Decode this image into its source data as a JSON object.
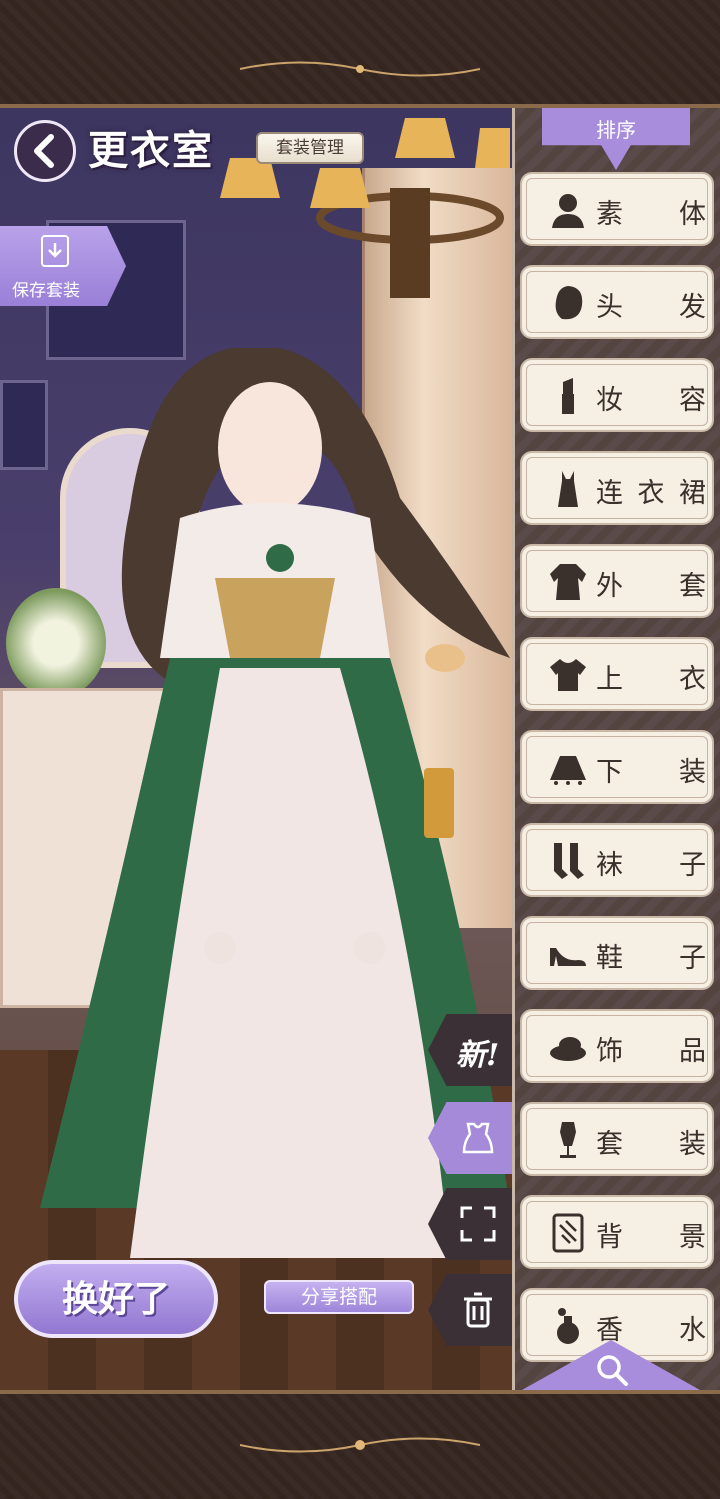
{
  "header": {
    "title": "更衣室",
    "outfit_management": "套装管理",
    "save_outfit": "保存套装"
  },
  "sidebar": {
    "sort_label": "排序",
    "categories": [
      {
        "label": "素 体",
        "icon": "body-icon"
      },
      {
        "label": "头 发",
        "icon": "hair-icon"
      },
      {
        "label": "妆 容",
        "icon": "lipstick-icon"
      },
      {
        "label": "连衣裙",
        "icon": "dress-icon"
      },
      {
        "label": "外 套",
        "icon": "coat-icon"
      },
      {
        "label": "上 衣",
        "icon": "top-icon"
      },
      {
        "label": "下 装",
        "icon": "skirt-icon"
      },
      {
        "label": "袜 子",
        "icon": "socks-icon"
      },
      {
        "label": "鞋 子",
        "icon": "shoe-icon"
      },
      {
        "label": "饰 品",
        "icon": "hat-icon"
      },
      {
        "label": "套 装",
        "icon": "mannequin-icon"
      },
      {
        "label": "背 景",
        "icon": "background-icon"
      },
      {
        "label": "香 水",
        "icon": "perfume-icon"
      }
    ],
    "search_icon": "search-icon"
  },
  "side_controls": {
    "new_label": "新!",
    "outfit_icon": "outfit-icon",
    "expand_icon": "expand-icon",
    "delete_icon": "trash-icon"
  },
  "footer": {
    "done_label": "换好了",
    "share_label": "分享搭配"
  },
  "colors": {
    "accent_purple": "#a88ddc",
    "dark_panel": "#3b3035",
    "card_bg": "#f6efe3"
  }
}
